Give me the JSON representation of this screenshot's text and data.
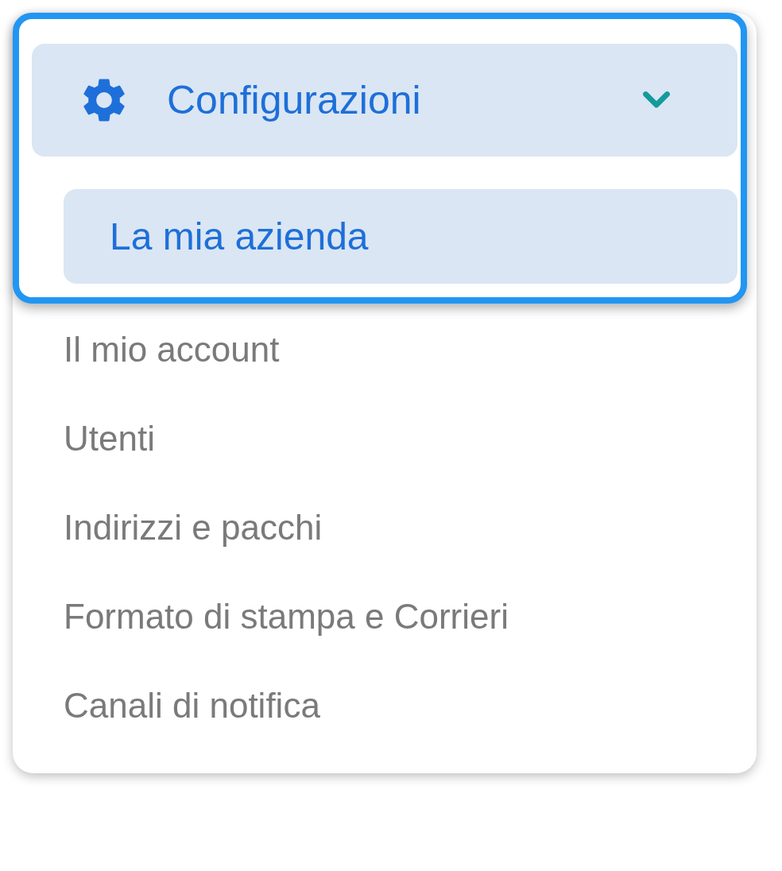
{
  "menu": {
    "title": "Configurazioni",
    "expanded": true,
    "items": [
      {
        "label": "La mia azienda",
        "selected": true,
        "highlighted": true
      },
      {
        "label": "Il mio account",
        "selected": false,
        "highlighted": false
      },
      {
        "label": "Utenti",
        "selected": false,
        "highlighted": false
      },
      {
        "label": "Indirizzi e pacchi",
        "selected": false,
        "highlighted": false
      },
      {
        "label": "Formato di stampa e Corrieri",
        "selected": false,
        "highlighted": false
      },
      {
        "label": "Canali di notifica",
        "selected": false,
        "highlighted": false
      }
    ]
  }
}
